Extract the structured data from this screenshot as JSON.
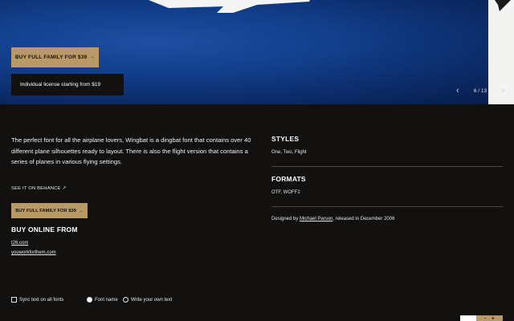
{
  "hero": {
    "buy_button": "BUY FULL FAMILY FOR $39",
    "buy_arrow": "→",
    "license_text": "Individual license starting from $19",
    "pager": {
      "prev": "‹",
      "label": "6 / 13",
      "next": "›"
    }
  },
  "main": {
    "description": "The perfect font for all the airplane lovers, Wingbat is a dingbat font that contains over 40 different plane silhouettes ready to layout. There is also the flight version that contains a series of planes in various flying settings.",
    "behance_link": "SEE IT ON BEHANCE",
    "behance_arrow": "↗",
    "buy_button": "BUY FULL FAMILY FOR $39",
    "buy_arrow": "→",
    "buy_online_title": "BUY ONLINE FROM",
    "stores": [
      "t26.com",
      "youworkforthem.com"
    ]
  },
  "details": {
    "styles_title": "STYLES",
    "styles_value": "One, Two, Flight",
    "formats_title": "FORMATS",
    "formats_value": "OTF, WOFF2",
    "credits_prefix": "Designed by ",
    "designer": "Michael Parson",
    "credits_suffix": ", released in December 2006"
  },
  "controls": {
    "sync_label": "Sync text on all fonts",
    "font_name_label": "Font name",
    "write_own_label": "Write your own text",
    "zoom_minus": "-",
    "zoom_plus": "+"
  },
  "colors": {
    "accent": "#b99a66",
    "background": "#121110",
    "hero_blue": "#123f8c"
  }
}
